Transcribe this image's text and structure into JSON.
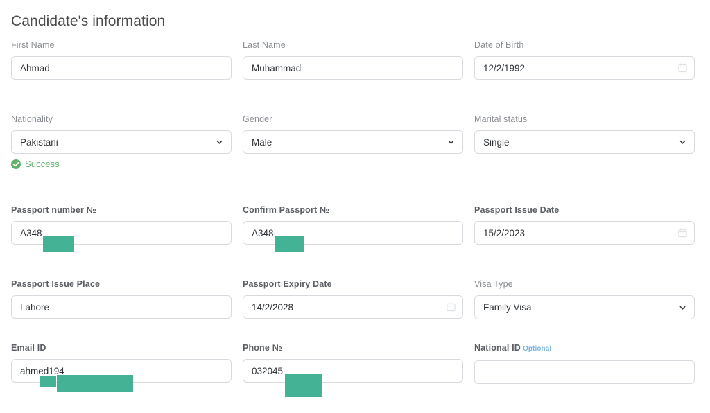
{
  "header": {
    "title": "Candidate's information"
  },
  "colors": {
    "redaction": "#44b295",
    "success": "#5fb16b",
    "optional_tag": "#7eb6e0",
    "label": "#8b8f94",
    "border": "#d7dade",
    "value_text": "#2f3337",
    "title": "#4b4b4b"
  },
  "icons": {
    "chevron": "chevron-down-icon",
    "calendar": "calendar-icon",
    "check": "check-circle-icon"
  },
  "form": {
    "rows": [
      {
        "fields": [
          {
            "key": "first_name",
            "label": "First Name",
            "type": "text",
            "value": "Ahmad",
            "placeholder": ""
          },
          {
            "key": "last_name",
            "label": "Last Name",
            "type": "text",
            "value": "Muhammad",
            "placeholder": ""
          },
          {
            "key": "date_of_birth",
            "label": "Date of Birth",
            "type": "date",
            "value": "12/2/1992",
            "placeholder": ""
          }
        ]
      },
      {
        "fields": [
          {
            "key": "nationality",
            "label": "Nationality",
            "type": "select",
            "value": "Pakistani",
            "helper": "Success"
          },
          {
            "key": "gender",
            "label": "Gender",
            "type": "select",
            "value": "Male"
          },
          {
            "key": "marital_status",
            "label": "Marital status",
            "type": "select",
            "value": "Single"
          }
        ]
      },
      {
        "fields": [
          {
            "key": "passport_number",
            "label": "Passport number №",
            "type": "text",
            "value": "A348"
          },
          {
            "key": "confirm_passport_number",
            "label": "Confirm Passport №",
            "type": "text",
            "value": "A348"
          },
          {
            "key": "passport_issue_date",
            "label": "Passport Issue Date",
            "type": "date",
            "value": "15/2/2023"
          }
        ]
      },
      {
        "fields": [
          {
            "key": "passport_issue_place",
            "label": "Passport Issue Place",
            "type": "text",
            "value": "Lahore"
          },
          {
            "key": "passport_expiry_date",
            "label": "Passport Expiry Date",
            "type": "date",
            "value": "14/2/2028"
          },
          {
            "key": "visa_type",
            "label": "Visa Type",
            "type": "select",
            "value": "Family Visa"
          }
        ]
      },
      {
        "fields": [
          {
            "key": "email_id",
            "label": "Email ID",
            "type": "text",
            "value": "ahmed194"
          },
          {
            "key": "phone_number",
            "label": "Phone №",
            "type": "text",
            "value": "032045"
          },
          {
            "key": "national_id",
            "label": "National ID",
            "label_suffix": "Optional",
            "type": "text",
            "value": "",
            "placeholder": ""
          }
        ]
      }
    ]
  }
}
